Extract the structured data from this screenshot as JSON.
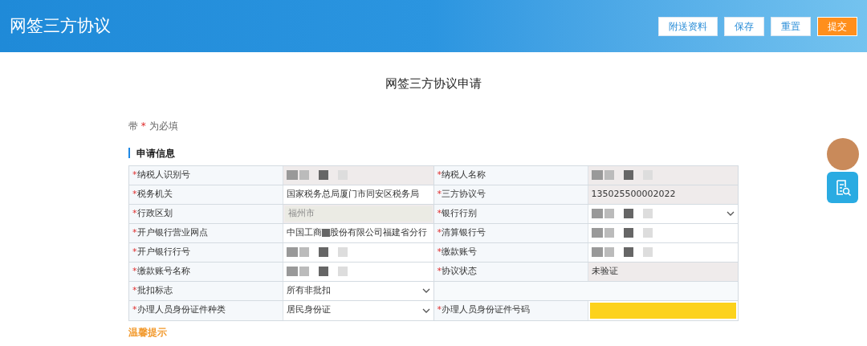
{
  "header": {
    "title": "网签三方协议",
    "buttons": [
      {
        "label": "附送资料",
        "kind": "plain"
      },
      {
        "label": "保存",
        "kind": "plain"
      },
      {
        "label": "重置",
        "kind": "plain"
      },
      {
        "label": "提交",
        "kind": "primary"
      }
    ]
  },
  "page_title": "网签三方协议申请",
  "required_note": {
    "before": "带",
    "mark": "*",
    "after": "为必填"
  },
  "section_title": "申请信息",
  "rows": [
    {
      "cells": [
        {
          "label": "纳税人识别号",
          "kind": "redacted",
          "readonly": true
        },
        {
          "label": "纳税人名称",
          "kind": "redacted",
          "readonly": true
        }
      ]
    },
    {
      "cells": [
        {
          "label": "税务机关",
          "kind": "text",
          "value": "国家税务总局厦门市同安区税务局",
          "readonly": false
        },
        {
          "label": "三方协议号",
          "kind": "text",
          "value": "135025500002022",
          "readonly": true
        }
      ]
    },
    {
      "cells": [
        {
          "label": "行政区划",
          "kind": "disabled",
          "value": "福州市",
          "readonly": true
        },
        {
          "label": "银行行别",
          "kind": "redacted-select",
          "readonly": false
        }
      ]
    },
    {
      "cells": [
        {
          "label": "开户银行营业网点",
          "kind": "partly-redacted",
          "value": "中国工商",
          "value_end": "股份有限公司福建省分行",
          "readonly": false
        },
        {
          "label": "清算银行号",
          "kind": "redacted",
          "readonly": false
        }
      ]
    },
    {
      "cells": [
        {
          "label": "开户银行行号",
          "kind": "redacted",
          "readonly": false
        },
        {
          "label": "缴款账号",
          "kind": "redacted",
          "readonly": false
        }
      ]
    },
    {
      "cells": [
        {
          "label": "缴款账号名称",
          "kind": "redacted",
          "readonly": false
        },
        {
          "label": "协议状态",
          "kind": "text",
          "value": "未验证",
          "readonly": true
        }
      ]
    },
    {
      "cells": [
        {
          "label": "批扣标志",
          "kind": "select",
          "value": "所有非批扣",
          "readonly": false
        },
        {
          "kind": "empty"
        }
      ]
    },
    {
      "cells": [
        {
          "label": "办理人员身份证件种类",
          "kind": "select",
          "value": "居民身份证",
          "readonly": false
        },
        {
          "label": "办理人员身份证件号码",
          "kind": "highlighted",
          "readonly": false
        }
      ]
    }
  ],
  "tips_title": "温馨提示"
}
